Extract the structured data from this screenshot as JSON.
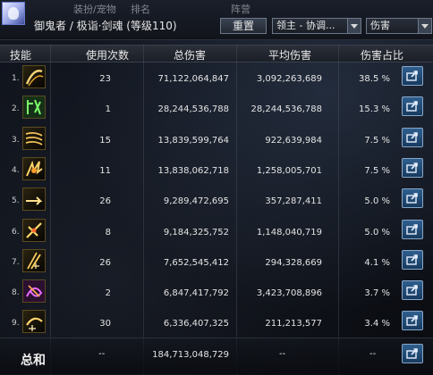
{
  "header": {
    "character_name": "御鬼者 / 极诣·剑魂 (等级110)",
    "background_tabs": [
      "装扮/宠物",
      "排名",
      "阵营"
    ],
    "reset_label": "重置",
    "role_select": "领主 - 协调...",
    "metric_select": "伤害"
  },
  "columns": {
    "skill": "技能",
    "uses": "使用次数",
    "total": "总伤害",
    "avg": "平均伤害",
    "pct": "伤害占比"
  },
  "rows": [
    {
      "rank": "1.",
      "uses": "23",
      "total": "71,122,064,847",
      "avg": "3,092,263,689",
      "pct": "38.5 %",
      "icon": "crescent-slash-icon"
    },
    {
      "rank": "2.",
      "uses": "1",
      "total": "28,244,536,788",
      "avg": "28,244,536,788",
      "pct": "15.3 %",
      "icon": "green-glyph-icon"
    },
    {
      "rank": "3.",
      "uses": "15",
      "total": "13,839,599,764",
      "avg": "922,639,984",
      "pct": "7.5 %",
      "icon": "triple-slash-icon"
    },
    {
      "rank": "4.",
      "uses": "11",
      "total": "13,838,062,718",
      "avg": "1,258,005,701",
      "pct": "7.5 %",
      "icon": "burst-slash-icon"
    },
    {
      "rank": "5.",
      "uses": "26",
      "total": "9,289,472,695",
      "avg": "357,287,411",
      "pct": "5.0 %",
      "icon": "dash-slash-icon"
    },
    {
      "rank": "6.",
      "uses": "8",
      "total": "9,184,325,752",
      "avg": "1,148,040,719",
      "pct": "5.0 %",
      "icon": "cross-blade-icon"
    },
    {
      "rank": "7.",
      "uses": "26",
      "total": "7,652,545,412",
      "avg": "294,328,669",
      "pct": "4.1 %",
      "icon": "flow-blade-icon"
    },
    {
      "rank": "8.",
      "uses": "2",
      "total": "6,847,417,792",
      "avg": "3,423,708,896",
      "pct": "3.7 %",
      "icon": "purple-swirl-icon"
    },
    {
      "rank": "9.",
      "uses": "30",
      "total": "6,336,407,325",
      "avg": "211,213,577",
      "pct": "3.4 %",
      "icon": "flow-arc-icon"
    }
  ],
  "summary": {
    "label": "总和",
    "uses": "--",
    "total": "184,713,048,729",
    "avg": "--",
    "pct": "--"
  },
  "colors": {
    "accent_button": "#2f5f8e",
    "text": "#e4e4e4",
    "header_bg": "#1b1f27"
  }
}
